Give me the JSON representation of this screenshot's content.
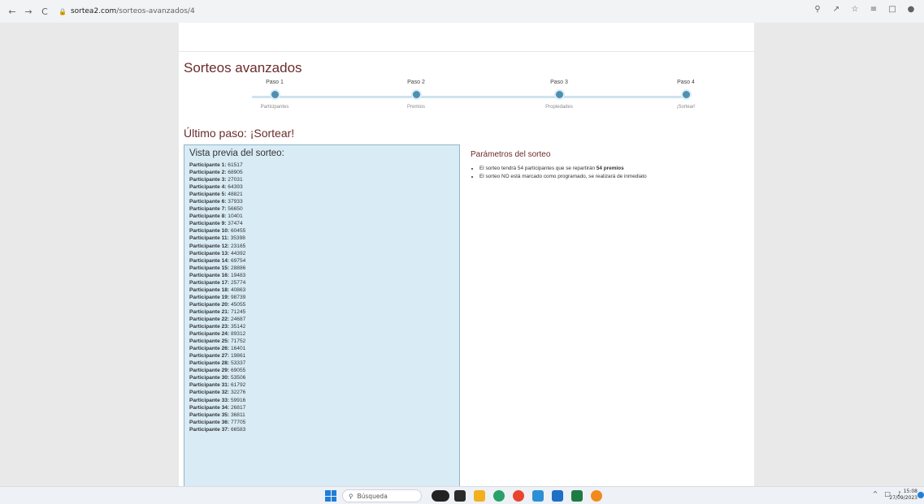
{
  "browser": {
    "nav": {
      "back": "←",
      "forward": "→",
      "reload": "C"
    },
    "url_domain": "sortea2.com",
    "url_path": "/sorteos-avanzados/4",
    "right_icons": [
      "zoom-icon",
      "share-icon",
      "star-icon",
      "list-icon",
      "sidebar-icon",
      "profile-icon"
    ]
  },
  "page": {
    "title": "Sorteos avanzados",
    "steps": [
      {
        "label": "Paso 1",
        "sub": "Participantes"
      },
      {
        "label": "Paso 2",
        "sub": "Premios"
      },
      {
        "label": "Paso 3",
        "sub": "Propiedades"
      },
      {
        "label": "Paso 4",
        "sub": "¡Sortear!"
      }
    ],
    "last_step_title": "Último paso: ¡Sortear!",
    "preview_title": "Vista previa del sorteo:",
    "participants": [
      {
        "label": "Participante 1:",
        "value": "61517"
      },
      {
        "label": "Participante 2:",
        "value": "68905"
      },
      {
        "label": "Participante 3:",
        "value": "27031"
      },
      {
        "label": "Participante 4:",
        "value": "64393"
      },
      {
        "label": "Participante 5:",
        "value": "48821"
      },
      {
        "label": "Participante 6:",
        "value": "37933"
      },
      {
        "label": "Participante 7:",
        "value": "56650"
      },
      {
        "label": "Participante 8:",
        "value": "10401"
      },
      {
        "label": "Participante 9:",
        "value": "37474"
      },
      {
        "label": "Participante 10:",
        "value": "60455"
      },
      {
        "label": "Participante 11:",
        "value": "35398"
      },
      {
        "label": "Participante 12:",
        "value": "23165"
      },
      {
        "label": "Participante 13:",
        "value": "44392"
      },
      {
        "label": "Participante 14:",
        "value": "69754"
      },
      {
        "label": "Participante 15:",
        "value": "28886"
      },
      {
        "label": "Participante 16:",
        "value": "19483"
      },
      {
        "label": "Participante 17:",
        "value": "25774"
      },
      {
        "label": "Participante 18:",
        "value": "40863"
      },
      {
        "label": "Participante 19:",
        "value": "98739"
      },
      {
        "label": "Participante 20:",
        "value": "45055"
      },
      {
        "label": "Participante 21:",
        "value": "71245"
      },
      {
        "label": "Participante 22:",
        "value": "24687"
      },
      {
        "label": "Participante 23:",
        "value": "35142"
      },
      {
        "label": "Participante 24:",
        "value": "89312"
      },
      {
        "label": "Participante 25:",
        "value": "71752"
      },
      {
        "label": "Participante 26:",
        "value": "16401"
      },
      {
        "label": "Participante 27:",
        "value": "19861"
      },
      {
        "label": "Participante 28:",
        "value": "53337"
      },
      {
        "label": "Participante 29:",
        "value": "69055"
      },
      {
        "label": "Participante 30:",
        "value": "53506"
      },
      {
        "label": "Participante 31:",
        "value": "61792"
      },
      {
        "label": "Participante 32:",
        "value": "32276"
      },
      {
        "label": "Participante 33:",
        "value": "59916"
      },
      {
        "label": "Participante 34:",
        "value": "26817"
      },
      {
        "label": "Participante 35:",
        "value": "36811"
      },
      {
        "label": "Participante 36:",
        "value": "77705"
      },
      {
        "label": "Participante 37:",
        "value": "66583"
      }
    ],
    "params_title": "Parámetros del sorteo",
    "params": {
      "line1_pre": "El sorteo tendrá 54 participantes que se repartirán ",
      "line1_bold": "54 premios",
      "line2": "El sorteo NO está marcado como programado, se realizará de inmediato"
    }
  },
  "taskbar": {
    "search_label": "Búsqueda",
    "time": "15:08",
    "date": "27/09/2023"
  },
  "colors": {
    "accent": "#6b2b2b",
    "step_dot": "#4f8fb0",
    "preview_bg": "#d9ecf5"
  }
}
